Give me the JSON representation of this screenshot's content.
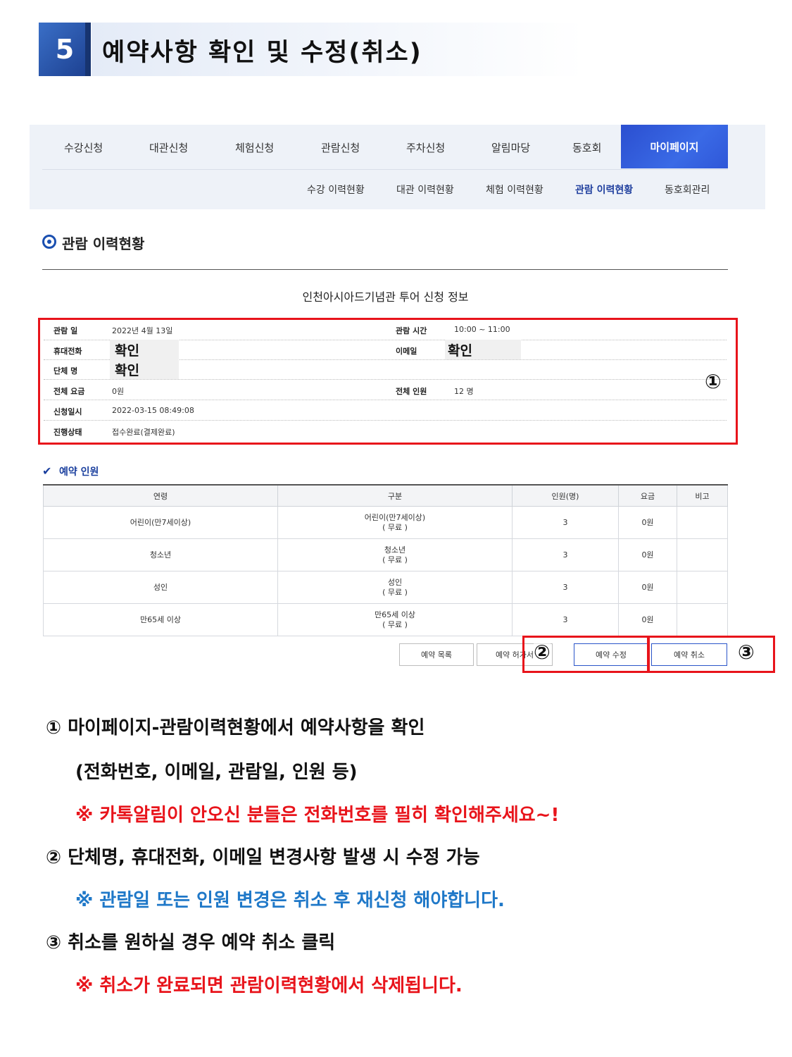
{
  "step": {
    "number": "5",
    "title": "예약사항 확인 및 수정(취소)"
  },
  "nav": {
    "items": [
      "수강신청",
      "대관신청",
      "체험신청",
      "관람신청",
      "주차신청",
      "알림마당",
      "동호회"
    ],
    "active": "마이페이지",
    "sub_items": [
      "수강 이력현황",
      "대관 이력현황",
      "체험 이력현황",
      "관람 이력현황",
      "동호회관리"
    ]
  },
  "section": {
    "title": "관람 이력현황",
    "tour_title": "인천아시아드기념관 투어 신청 정보"
  },
  "info": {
    "visit_date_label": "관람 일",
    "visit_date": "2022년 4월 13일",
    "visit_time_label": "관람 시간",
    "visit_time": "10:00 ~ 11:00",
    "phone_label": "휴대전화",
    "phone_mask": "확인",
    "email_label": "이메일",
    "email_mask": "확인",
    "group_label": "단체 명",
    "group_mask": "확인",
    "total_fee_label": "전체 요금",
    "total_fee": "0원",
    "total_people_label": "전체 인원",
    "total_people": "12 명",
    "apply_date_label": "신청일시",
    "apply_date": "2022-03-15 08:49:08",
    "status_label": "진행상태",
    "status": "접수완료(결제완료)"
  },
  "people": {
    "title": "예약 인원",
    "headers": [
      "연령",
      "구분",
      "인원(명)",
      "요금",
      "비고"
    ],
    "rows": [
      {
        "age": "어린이(만7세이상)",
        "type": "어린이(만7세이상)",
        "free": "( 무료 )",
        "count": "3",
        "fee": "0원",
        "note": ""
      },
      {
        "age": "청소년",
        "type": "청소년",
        "free": "( 무료 )",
        "count": "3",
        "fee": "0원",
        "note": ""
      },
      {
        "age": "성인",
        "type": "성인",
        "free": "( 무료 )",
        "count": "3",
        "fee": "0원",
        "note": ""
      },
      {
        "age": "만65세 이상",
        "type": "만65세 이상",
        "free": "( 무료 )",
        "count": "3",
        "fee": "0원",
        "note": ""
      }
    ]
  },
  "buttons": {
    "list": "예약 목록",
    "print": "예약 허가서",
    "edit": "예약 수정",
    "cancel": "예약 취소"
  },
  "markers": {
    "one": "①",
    "two": "②",
    "three": "③"
  },
  "instructions": {
    "line1": "① 마이페이지-관람이력현황에서 예약사항을 확인",
    "line2": "(전화번호, 이메일, 관람일, 인원 등)",
    "line3": "※ 카톡알림이 안오신 분들은 전화번호를 필히 확인해주세요~!",
    "line4": "② 단체명, 휴대전화, 이메일 변경사항 발생 시 수정 가능",
    "line5": "※ 관람일 또는 인원 변경은 취소 후 재신청 해야합니다.",
    "line6": "③ 취소를 원하실 경우 예약 취소 클릭",
    "line7": "※ 취소가 완료되면 관람이력현황에서 삭제됩니다."
  },
  "colors": {
    "accent_red": "#e8141b",
    "accent_blue": "#1f78c8",
    "nav_active": "#2b4fd0"
  }
}
